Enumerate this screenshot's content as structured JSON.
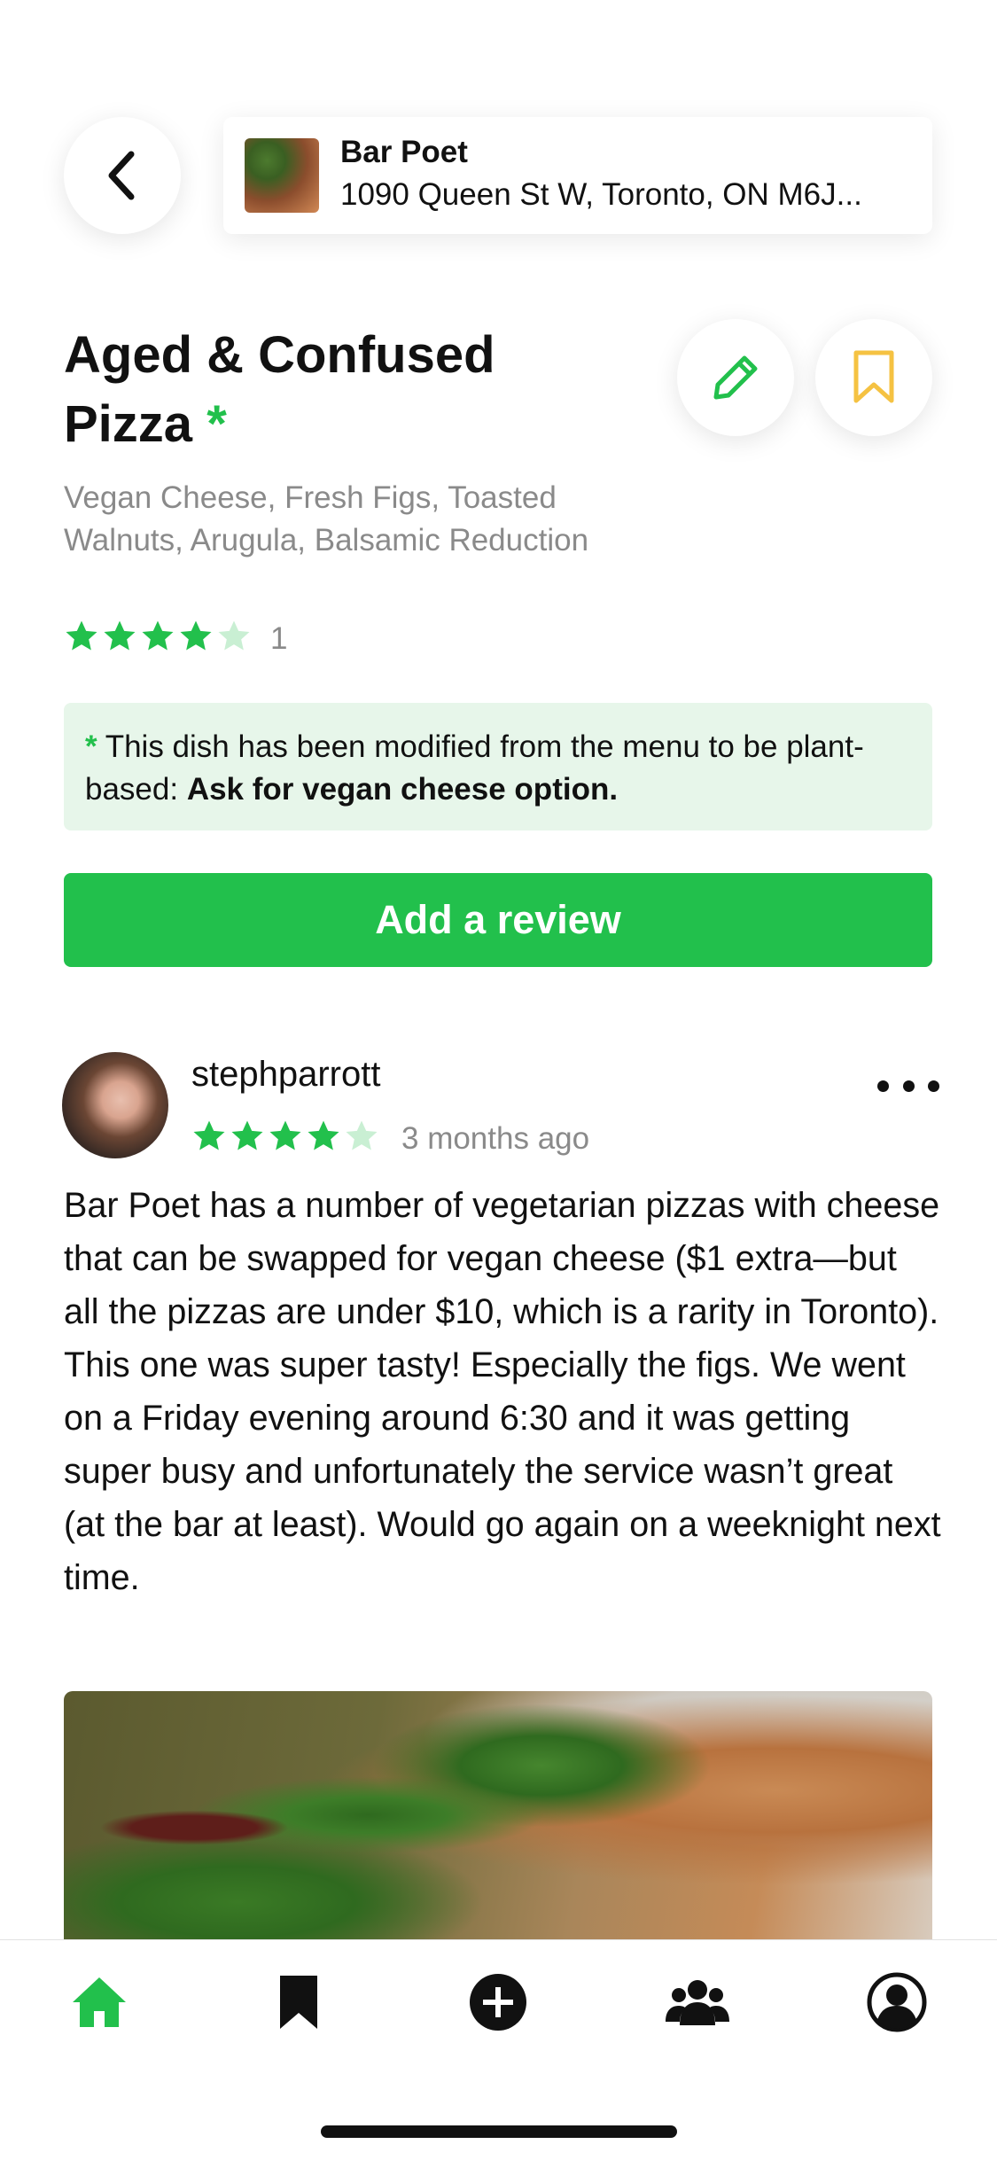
{
  "colors": {
    "accent": "#22c04c",
    "bookmark": "#f5c242",
    "muted": "#8a8a8a",
    "notice_bg": "#e7f6ea"
  },
  "header": {
    "back_icon": "chevron-left-icon",
    "restaurant": {
      "name": "Bar Poet",
      "address": "1090 Queen St W, Toronto, ON M6J..."
    }
  },
  "dish": {
    "title": "Aged & Confused Pizza",
    "modified_marker": "*",
    "description": "Vegan Cheese, Fresh Figs, Toasted Walnuts, Arugula, Balsamic Reduction",
    "rating": 4,
    "rating_max": 5,
    "rating_count": "1",
    "actions": {
      "edit_icon": "pencil-icon",
      "bookmark_icon": "bookmark-outline-icon"
    }
  },
  "notice": {
    "marker": "*",
    "text": " This dish has been modified from the menu to be plant-based: ",
    "bold": "Ask for vegan cheese option."
  },
  "add_review_label": "Add a review",
  "review": {
    "username": "stephparrott",
    "rating": 4,
    "rating_max": 5,
    "time_ago": "3 months ago",
    "body": "Bar Poet has a number of vegetarian pizzas with cheese that can be swapped for vegan cheese ($1 extra—but all the pizzas are under $10, which is a rarity in Toronto). This one was super tasty! Especially the figs. We went on a Friday evening around 6:30 and it was getting super busy and unfortunately the service wasn’t great (at the bar at least). Would go again on a weeknight next time.",
    "more_icon": "more-horizontal-icon"
  },
  "tabbar": {
    "items": [
      {
        "icon": "home-icon",
        "active": true
      },
      {
        "icon": "bookmark-icon",
        "active": false
      },
      {
        "icon": "add-circle-icon",
        "active": false
      },
      {
        "icon": "people-icon",
        "active": false
      },
      {
        "icon": "profile-icon",
        "active": false
      }
    ]
  }
}
